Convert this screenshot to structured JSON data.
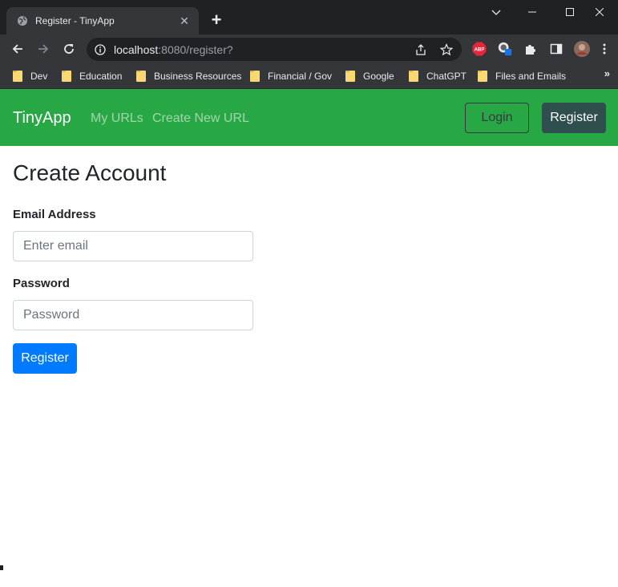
{
  "browser": {
    "tab_title": "Register - TinyApp",
    "url_host": "localhost",
    "url_path": ":8080/register?",
    "bookmarks": [
      "Dev",
      "Education",
      "Business Resources",
      "Financial / Gov",
      "Google",
      "ChatGPT",
      "Files and Emails"
    ],
    "extension_abp_label": "ABP",
    "more_bookmarks": "»"
  },
  "navbar": {
    "brand": "TinyApp",
    "links": [
      "My URLs",
      "Create New URL"
    ],
    "login_label": "Login",
    "register_label": "Register"
  },
  "form": {
    "title": "Create Account",
    "email_label": "Email Address",
    "email_placeholder": "Enter email",
    "email_value": "",
    "password_label": "Password",
    "password_placeholder": "Password",
    "password_value": "",
    "submit_label": "Register"
  },
  "colors": {
    "navbar_bg": "#28a745",
    "primary": "#007bff",
    "register_nav_bg": "#2f4f4f"
  }
}
